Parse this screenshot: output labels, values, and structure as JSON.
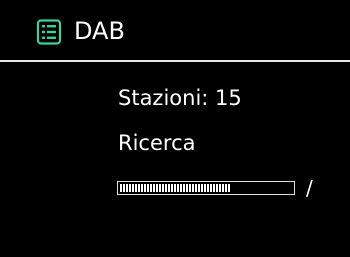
{
  "header": {
    "icon": "menu-list-icon",
    "title": "DAB"
  },
  "scan": {
    "stations_label": "Stazioni: 15",
    "status": "Ricerca",
    "progress": 0.64,
    "spinner": "/"
  },
  "colors": {
    "background": "#000000",
    "text": "#ffffff",
    "icon_accent": "#3fcf9a"
  }
}
